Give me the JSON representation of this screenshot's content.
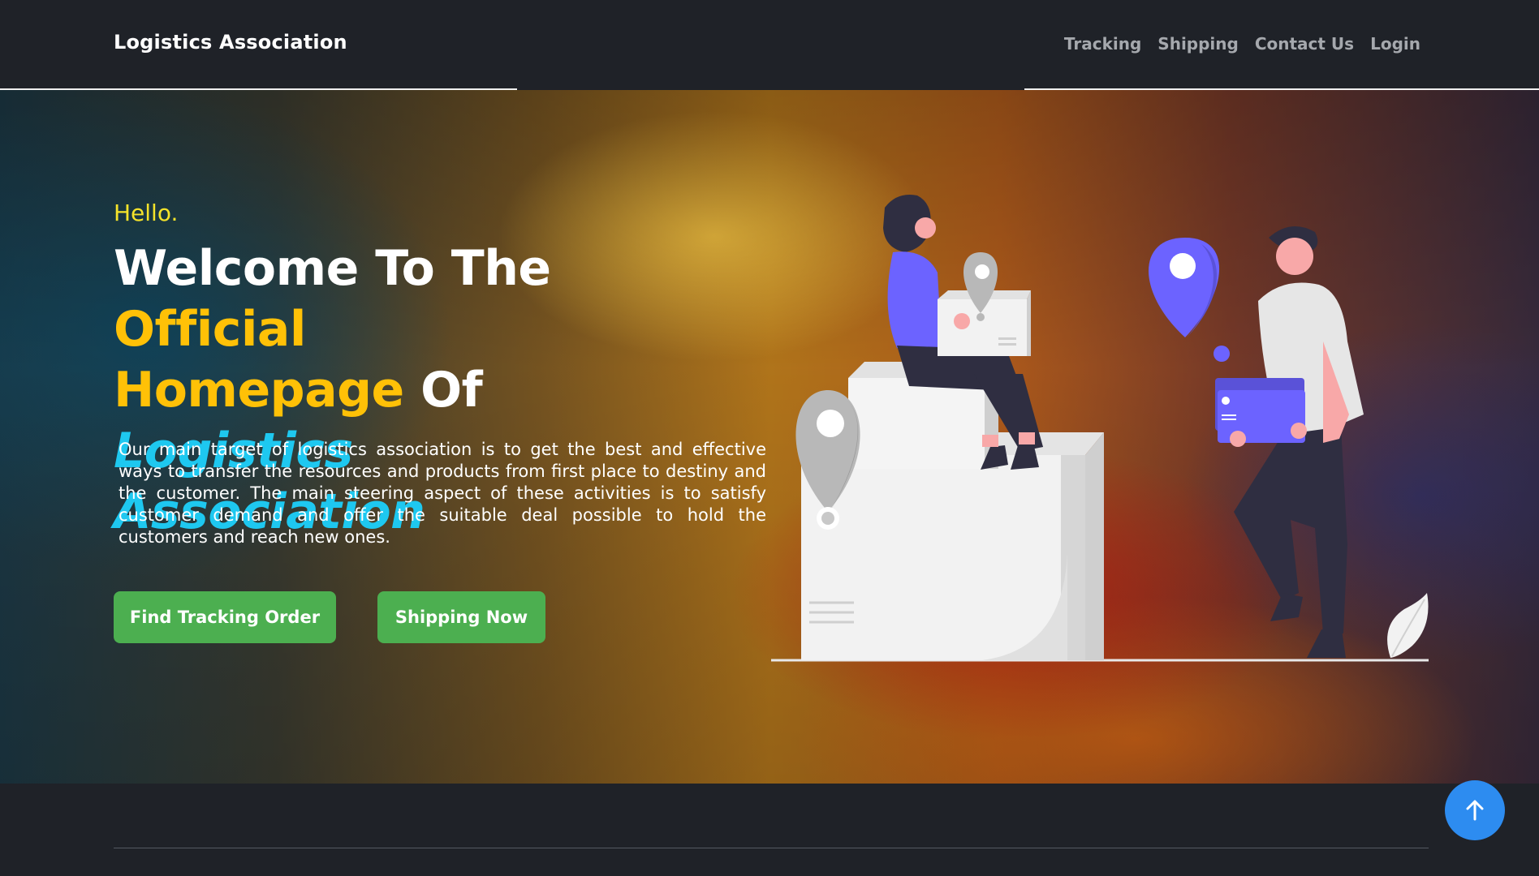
{
  "navbar": {
    "brand": "Logistics Association",
    "links": [
      "Tracking",
      "Shipping",
      "Contact Us",
      "Login"
    ]
  },
  "hero": {
    "greeting": "Hello.",
    "headline": {
      "part1": "Welcome To The ",
      "part2": "Official",
      "part3": "Homepage",
      "part4": " Of ",
      "part5": "Logistics",
      "part6": "Association"
    },
    "description": "Our main target of logistics association is to get the best and effective ways to transfer the resources and products from first place to destiny and the customer. The main steering aspect of these activities is to satisfy customer demand and offer the suitable deal possible to hold the customers and reach new ones.",
    "buttons": {
      "track_label": "Find Tracking Order",
      "ship_label": "Shipping Now"
    }
  },
  "scroll_top": {
    "icon": "arrow-up-icon"
  },
  "colors": {
    "accent_gold": "#ffc107",
    "accent_cyan": "#1ec8f0",
    "greeting_yellow": "#f5e32a",
    "button_green": "#4caf50",
    "scroll_blue": "#2d8cf0",
    "illustration_purple": "#6c63ff"
  }
}
